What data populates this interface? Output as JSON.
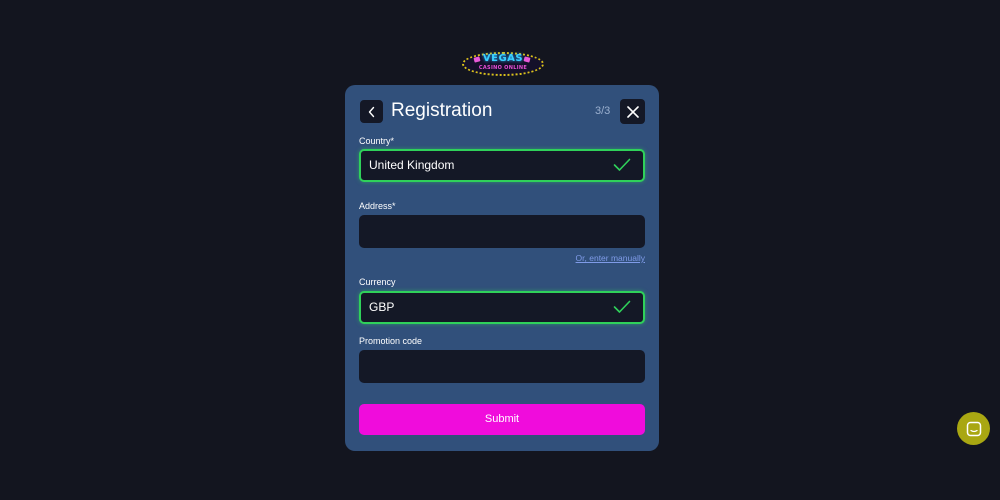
{
  "logo": {
    "title": "VEGAS",
    "subtitle": "CASINO ONLINE"
  },
  "modal": {
    "title": "Registration",
    "step": "3/3",
    "back_icon": "chevron-left-icon",
    "close_icon": "close-icon"
  },
  "form": {
    "country": {
      "label": "Country*",
      "value": "United Kingdom",
      "valid": true
    },
    "address": {
      "label": "Address*",
      "value": "",
      "manual_link": "Or, enter manually"
    },
    "currency": {
      "label": "Currency",
      "value": "GBP",
      "valid": true
    },
    "promotion": {
      "label": "Promotion code",
      "value": ""
    },
    "submit_label": "Submit"
  },
  "chat": {
    "icon": "chat-icon"
  },
  "colors": {
    "background": "#13151f",
    "card": "#31507b",
    "input": "#141826",
    "valid": "#2fd15a",
    "submit": "#f00cdc",
    "link": "#7f9be8",
    "chat": "#a9a712"
  }
}
